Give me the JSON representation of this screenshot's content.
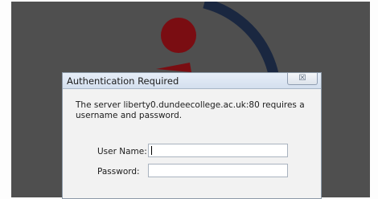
{
  "dialog": {
    "title": "Authentication Required",
    "close_label": "☒",
    "message": "The server liberty0.dundeecollege.ac.uk:80  requires a username and password.",
    "username_label": "User Name:",
    "username_value": "",
    "password_label": "Password:",
    "password_value": ""
  },
  "colors": {
    "background_panel": "#4f4f4f",
    "logo_red": "#7a0d12",
    "logo_navy": "#1a2740",
    "titlebar": "#dce6f3"
  },
  "icons": {
    "close": "close-icon"
  }
}
